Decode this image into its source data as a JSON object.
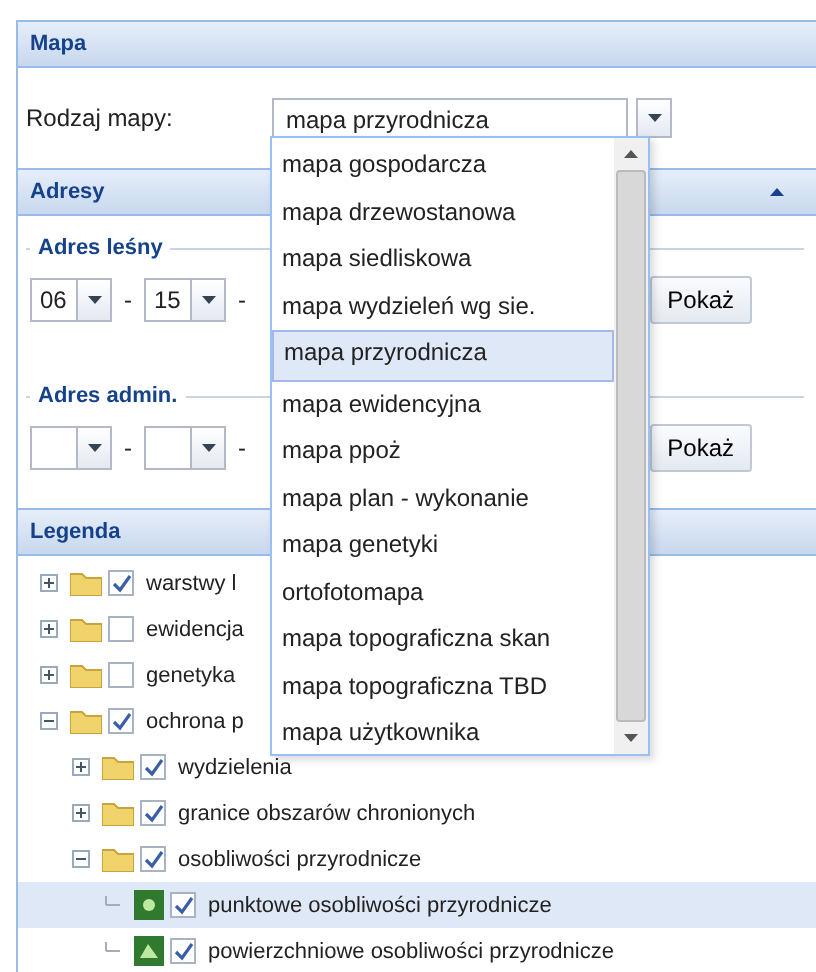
{
  "map_panel": {
    "title": "Mapa",
    "label": "Rodzaj mapy:",
    "value": "mapa przyrodnicza"
  },
  "dropdown": {
    "options": [
      {
        "label": "mapa gospodarcza",
        "selected": false
      },
      {
        "label": "mapa drzewostanowa",
        "selected": false
      },
      {
        "label": "mapa siedliskowa",
        "selected": false
      },
      {
        "label": "mapa wydzieleń wg sie.",
        "selected": false
      },
      {
        "label": "mapa przyrodnicza",
        "selected": true
      },
      {
        "label": "mapa ewidencyjna",
        "selected": false
      },
      {
        "label": "mapa ppoż",
        "selected": false
      },
      {
        "label": "mapa plan - wykonanie",
        "selected": false
      },
      {
        "label": "mapa genetyki",
        "selected": false
      },
      {
        "label": "ortofotomapa",
        "selected": false
      },
      {
        "label": "mapa topograficzna skan",
        "selected": false
      },
      {
        "label": "mapa topograficzna TBD",
        "selected": false
      },
      {
        "label": "mapa użytkownika",
        "selected": false
      }
    ]
  },
  "addresses": {
    "title": "Adresy",
    "forest": {
      "legend": "Adres leśny",
      "fields": [
        "06",
        "15"
      ],
      "separators": [
        "-",
        "-"
      ],
      "button": "Pokaż"
    },
    "admin": {
      "legend": "Adres admin.",
      "separators": [
        "-",
        "-"
      ],
      "button": "Pokaż"
    }
  },
  "legend": {
    "title": "Legenda",
    "items": [
      {
        "label": "warstwy l",
        "kind": "folder",
        "checked": true,
        "expanded": false,
        "selected": false
      },
      {
        "label": "ewidencja",
        "kind": "folder",
        "checked": false,
        "expanded": false,
        "selected": false
      },
      {
        "label": "genetyka",
        "kind": "folder",
        "checked": false,
        "expanded": false,
        "selected": false
      },
      {
        "label": "ochrona p",
        "kind": "folder",
        "checked": true,
        "expanded": true,
        "selected": false,
        "children": [
          {
            "label": "wydzielenia",
            "kind": "folder",
            "checked": true,
            "expanded": false,
            "selected": false
          },
          {
            "label": "granice obszarów chronionych",
            "kind": "folder",
            "checked": true,
            "expanded": false,
            "selected": false
          },
          {
            "label": "osobliwości przyrodnicze",
            "kind": "folder",
            "checked": true,
            "expanded": true,
            "selected": false,
            "children": [
              {
                "label": "punktowe osobliwości przyrodnicze",
                "kind": "point-layer",
                "checked": true,
                "selected": true
              },
              {
                "label": "powierzchniowe osobliwości przyrodnicze",
                "kind": "area-layer",
                "checked": true,
                "selected": false
              }
            ]
          }
        ]
      }
    ]
  }
}
